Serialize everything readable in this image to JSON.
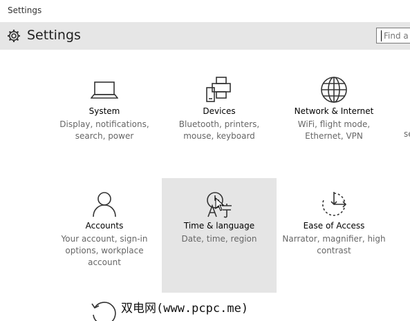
{
  "window": {
    "title": "Settings"
  },
  "header": {
    "title": "Settings",
    "icon": "gear-icon"
  },
  "search": {
    "placeholder": "Find a s"
  },
  "tiles": [
    {
      "name": "System",
      "desc": "Display, notifications, search, power",
      "icon": "laptop-icon"
    },
    {
      "name": "Devices",
      "desc": "Bluetooth, printers, mouse, keyboard",
      "icon": "devices-icon"
    },
    {
      "name": "Network & Internet",
      "desc": "WiFi, flight mode, Ethernet, VPN",
      "icon": "globe-icon"
    },
    {
      "name": "Accounts",
      "desc": "Your account, sign-in options, workplace account",
      "icon": "person-icon"
    },
    {
      "name": "Time & language",
      "desc": "Date, time, region",
      "icon": "clock-language-icon"
    },
    {
      "name": "Ease of Access",
      "desc": "Narrator, magnifier, high contrast",
      "icon": "ease-of-access-icon"
    }
  ],
  "partial_right_text": "se",
  "watermark": "双电网(www.pcpc.me)",
  "colors": {
    "header_bg": "#e6e6e6",
    "hover_bg": "#e5e5e5",
    "desc_text": "#666666"
  }
}
